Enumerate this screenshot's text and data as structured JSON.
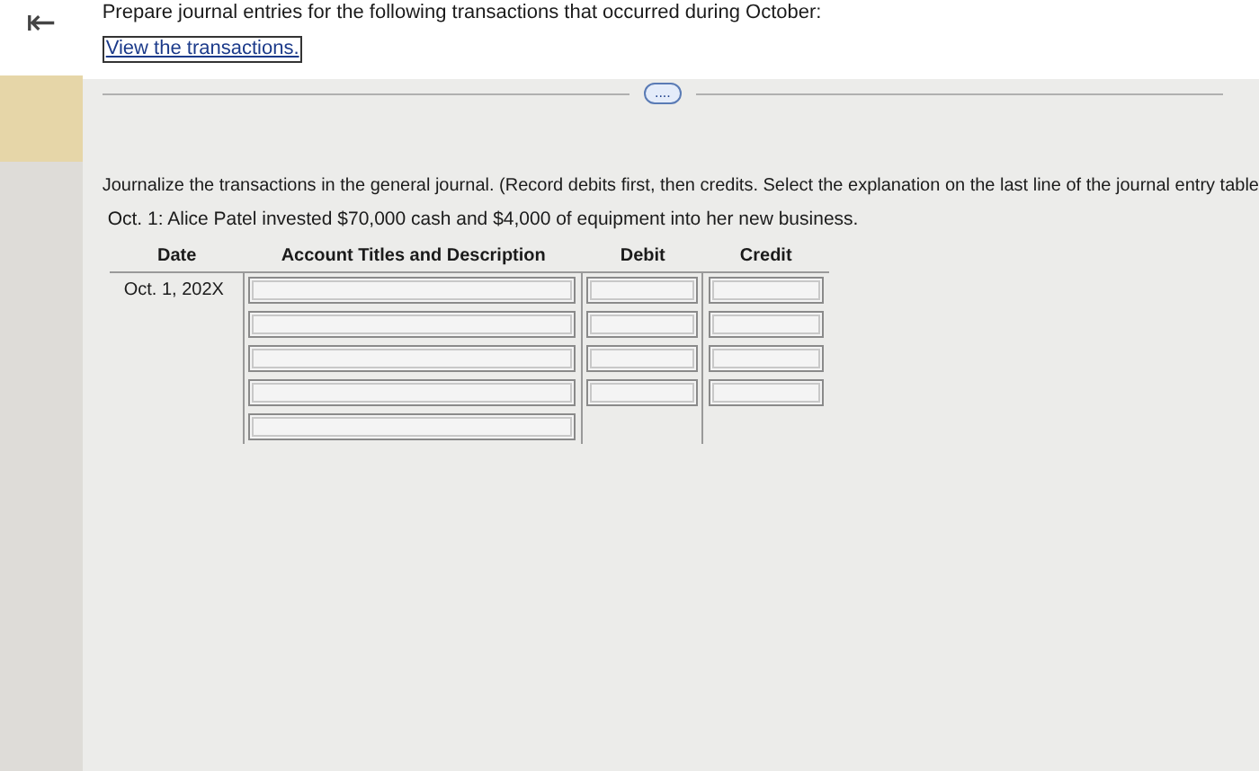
{
  "header": {
    "back_icon": "⇤",
    "title": "Prepare journal entries for the following transactions that occurred during October:",
    "link": "View the transactions."
  },
  "more_button": "....",
  "instructions": "Journalize the transactions in the general journal. (Record debits first, then credits. Select the explanation on the last line of the journal entry table",
  "transaction": "Oct. 1: Alice Patel invested $70,000 cash and $4,000 of equipment into her new business.",
  "table": {
    "columns": [
      "Date",
      "Account Titles and Description",
      "Debit",
      "Credit"
    ],
    "rows": [
      {
        "kind": "entry",
        "date": "Oct. 1, 202X"
      },
      {
        "kind": "entry"
      },
      {
        "kind": "entry"
      },
      {
        "kind": "entry"
      },
      {
        "kind": "explanation"
      }
    ]
  }
}
